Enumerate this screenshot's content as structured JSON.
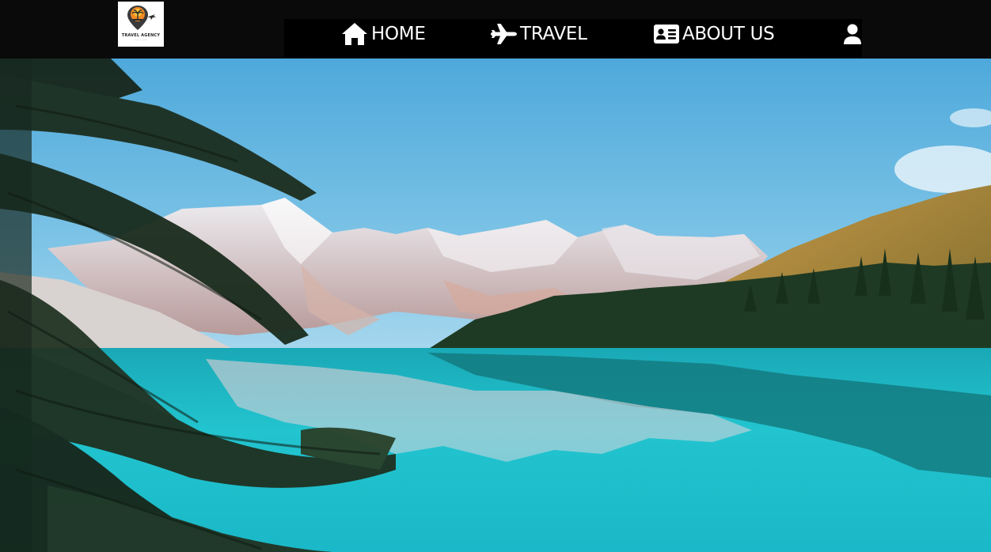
{
  "header": {
    "logo": {
      "text": "TRAVEL AGENCY",
      "icon": "map-pin-palm-plane-icon"
    },
    "nav": {
      "items": [
        {
          "label": "HOME",
          "icon": "home-icon"
        },
        {
          "label": "TRAVEL",
          "icon": "airplane-icon"
        },
        {
          "label": "ABOUT US",
          "icon": "id-card-icon"
        }
      ],
      "user_icon": "user-icon"
    }
  },
  "hero": {
    "image": "mountain-lake-landscape",
    "colors": {
      "sky": "#5fb6e0",
      "water": "#1fbfc7",
      "forest": "#1e3a22",
      "mountain": "#d8d6d8"
    }
  }
}
